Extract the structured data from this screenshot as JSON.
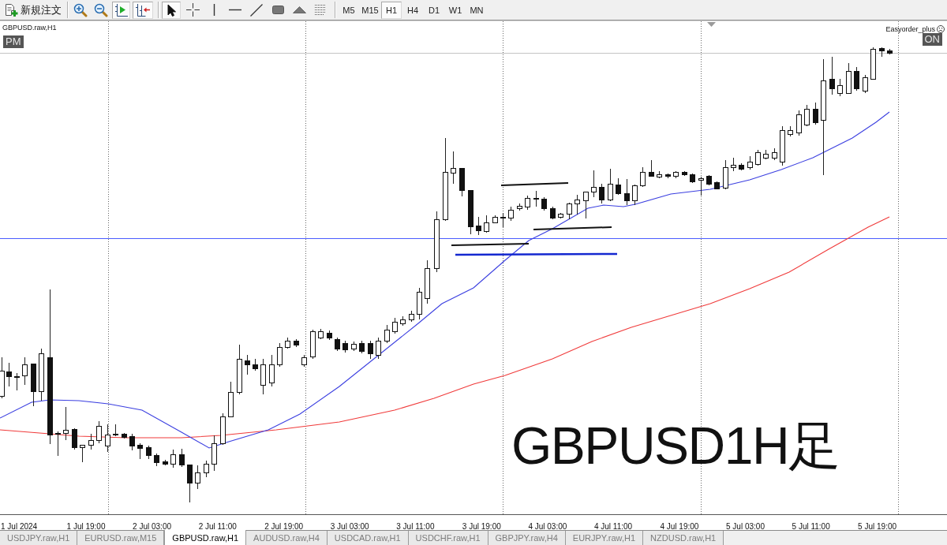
{
  "toolbar": {
    "new_order_button": {
      "label": "新規注文"
    },
    "view_buttons": [
      {
        "on": false
      },
      {
        "on": false
      },
      {
        "on": true
      },
      {
        "on": true
      }
    ],
    "drawing_tools": [
      {
        "selected": true
      },
      {
        "selected": false
      },
      {
        "selected": false
      },
      {
        "selected": false
      },
      {
        "selected": false
      },
      {
        "selected": false
      },
      {
        "selected": false
      },
      {
        "selected": false
      }
    ],
    "timeframes": [
      {
        "label": "M5",
        "selected": false
      },
      {
        "label": "M15",
        "selected": false
      },
      {
        "label": "H1",
        "selected": true
      },
      {
        "label": "H4",
        "selected": false
      },
      {
        "label": "D1",
        "selected": false
      },
      {
        "label": "W1",
        "selected": false
      },
      {
        "label": "MN",
        "selected": false
      }
    ]
  },
  "chart": {
    "symbol": "GBPUSD.raw,H1",
    "session_badge": "PM",
    "expert": {
      "name": "Easyorder_plus",
      "status": "ON"
    },
    "caption": "GBPUSD1H足"
  },
  "time_axis": {
    "labels": [
      "1 Jul 2024",
      "1 Jul 19:00",
      "2 Jul 03:00",
      "2 Jul 11:00",
      "2 Jul 19:00",
      "3 Jul 03:00",
      "3 Jul 11:00",
      "3 Jul 19:00",
      "4 Jul 03:00",
      "4 Jul 11:00",
      "4 Jul 19:00",
      "5 Jul 03:00",
      "5 Jul 11:00",
      "5 Jul 19:00"
    ]
  },
  "tabs": [
    {
      "label": "USDJPY.raw,H1",
      "selected": false
    },
    {
      "label": "EURUSD.raw,M15",
      "selected": false
    },
    {
      "label": "GBPUSD.raw,H1",
      "selected": true
    },
    {
      "label": "AUDUSD.raw,H4",
      "selected": false
    },
    {
      "label": "USDCAD.raw,H1",
      "selected": false
    },
    {
      "label": "USDCHF.raw,H1",
      "selected": false
    },
    {
      "label": "GBPJPY.raw,H4",
      "selected": false
    },
    {
      "label": "EURJPY.raw,H1",
      "selected": false
    },
    {
      "label": "NZDUSD.raw,H1",
      "selected": false
    }
  ]
}
